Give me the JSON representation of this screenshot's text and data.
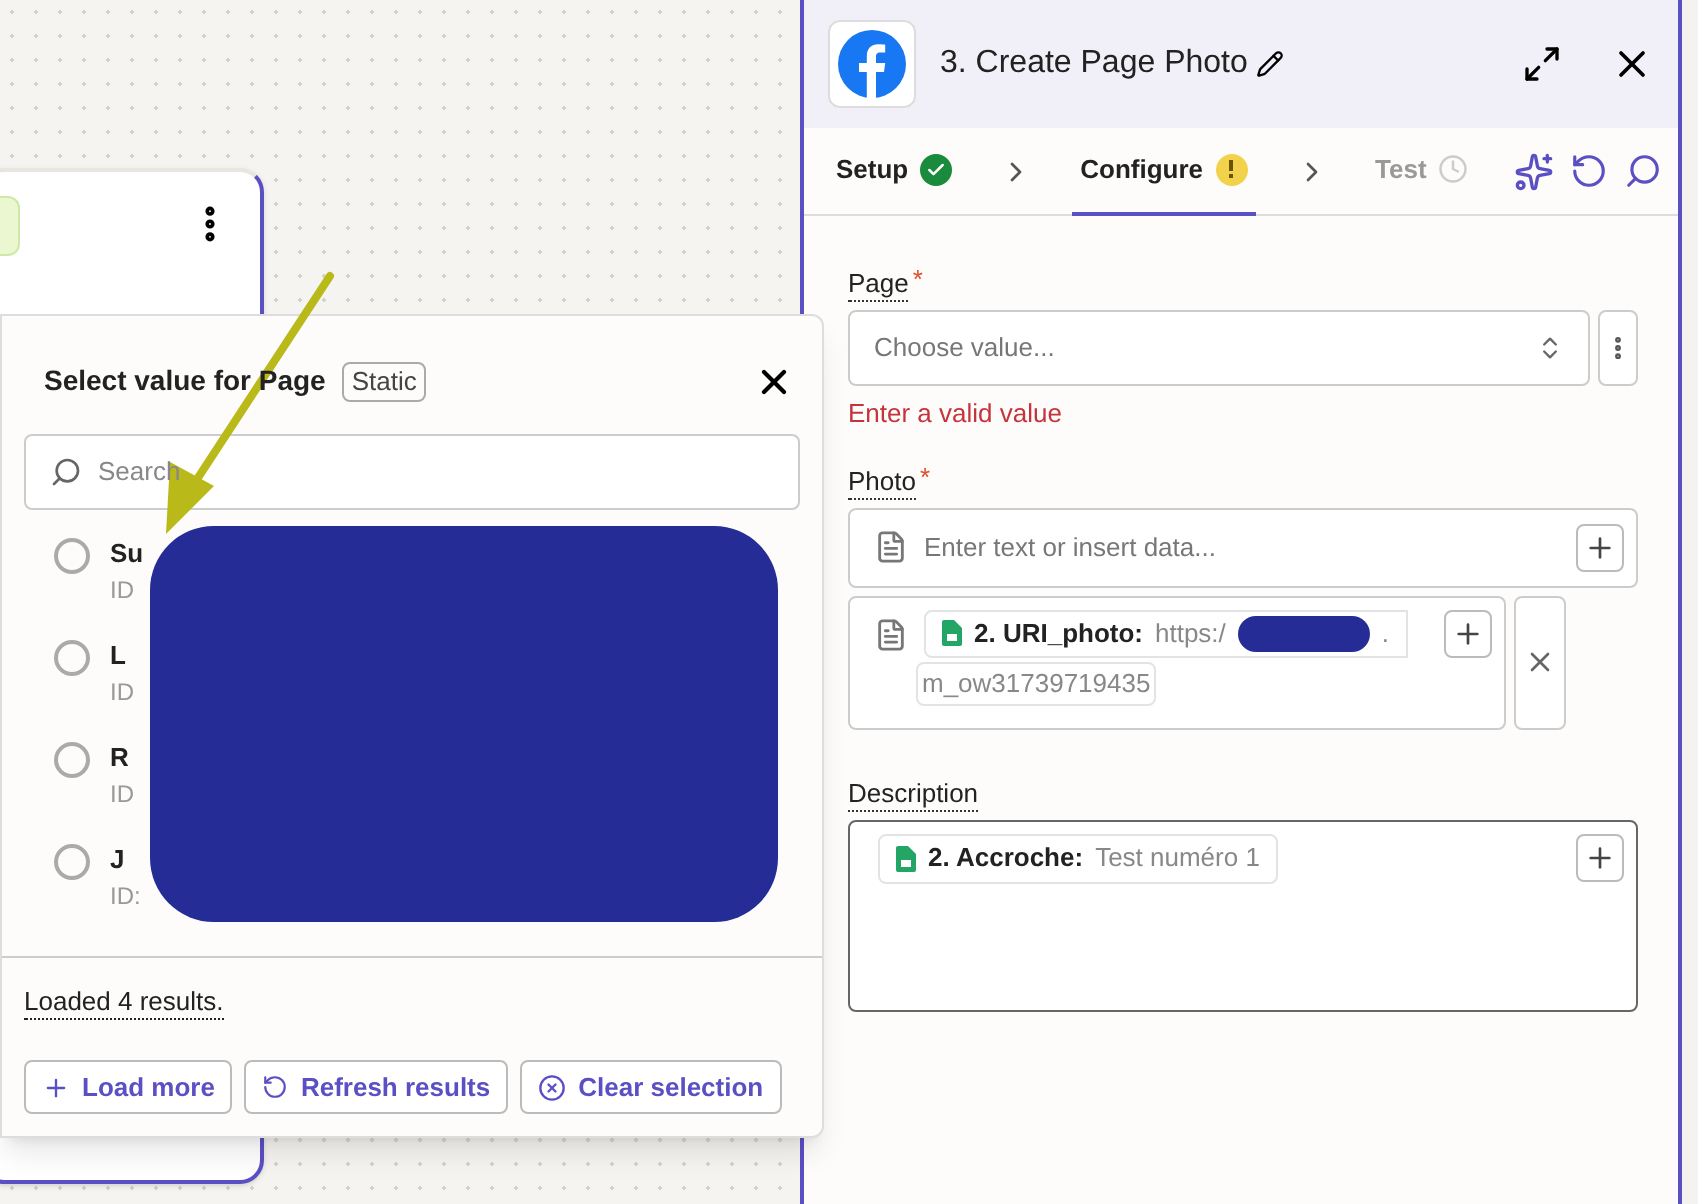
{
  "popup": {
    "title": "Select value for Page",
    "badge": "Static",
    "search": {
      "placeholder": "Search"
    },
    "options": [
      {
        "name": "Su",
        "id": "ID",
        "selected": false
      },
      {
        "name": "L",
        "id": "ID",
        "selected": false
      },
      {
        "name": "R",
        "id": "ID",
        "selected": false
      },
      {
        "name": "J",
        "id": "ID:",
        "selected": false
      }
    ],
    "status": "Loaded 4 results.",
    "buttons": [
      {
        "label": "Load more",
        "kind": "add"
      },
      {
        "label": "Refresh results",
        "kind": "refresh"
      },
      {
        "label": "Clear selection",
        "kind": "clear"
      }
    ]
  },
  "panel": {
    "title": "3. Create Page Photo",
    "steps": [
      {
        "label": "Setup",
        "kind": "done",
        "selected": false
      },
      {
        "label": "Configure",
        "kind": "warning",
        "selected": true
      },
      {
        "label": "Test",
        "kind": "pending",
        "selected": false
      }
    ],
    "page_field": {
      "label": "Page",
      "required_mark": "*",
      "placeholder": "Choose value...",
      "error": "Enter a valid value"
    },
    "photo_field": {
      "label": "Photo",
      "required_mark": "*",
      "placeholder": "Enter text or insert data...",
      "pill_label": "2. URI_photo:",
      "pill_value": "https:/",
      "pill_end": ".",
      "continuation": "m_ow31739719435"
    },
    "description_field": {
      "label": "Description",
      "pill_label": "2. Accroche:",
      "pill_value": "Test numéro 1"
    }
  }
}
